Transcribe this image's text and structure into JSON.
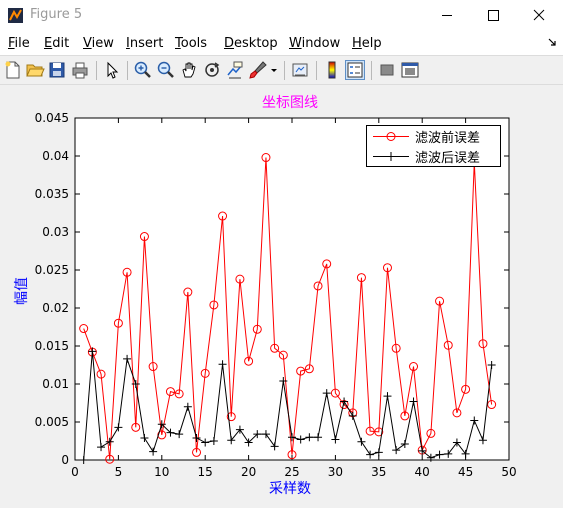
{
  "window": {
    "title": "Figure 5"
  },
  "menu": [
    {
      "mnemonic": "F",
      "rest": "ile"
    },
    {
      "mnemonic": "E",
      "rest": "dit"
    },
    {
      "mnemonic": "V",
      "rest": "iew"
    },
    {
      "mnemonic": "I",
      "rest": "nsert"
    },
    {
      "mnemonic": "T",
      "rest": "ools"
    },
    {
      "mnemonic": "D",
      "rest": "esktop"
    },
    {
      "mnemonic": "W",
      "rest": "indow"
    },
    {
      "mnemonic": "H",
      "rest": "elp"
    }
  ],
  "toolbar": [
    "new-figure-icon",
    "open-file-icon",
    "save-icon",
    "print-icon",
    "pointer-icon",
    "zoom-in-icon",
    "zoom-out-icon",
    "pan-icon",
    "rotate-3d-icon",
    "data-cursor-icon",
    "brush-icon",
    "link-icon",
    "colorbar-icon",
    "legend-icon",
    "hide-plot-tools-icon",
    "show-plot-tools-icon"
  ],
  "colors": {
    "series1": "#ff0000",
    "series2": "#000000",
    "title": "#ff00ff",
    "labels": "#0000ff"
  },
  "chart_data": {
    "type": "line",
    "title": "坐标图线",
    "xlabel": "采样数",
    "ylabel": "幅值",
    "xlim": [
      0,
      50
    ],
    "ylim": [
      0,
      0.045
    ],
    "xticks": [
      "0",
      "5",
      "10",
      "15",
      "20",
      "25",
      "30",
      "35",
      "40",
      "45",
      "50"
    ],
    "yticks": [
      "0",
      "0.005",
      "0.01",
      "0.015",
      "0.02",
      "0.025",
      "0.03",
      "0.035",
      "0.04",
      "0.045"
    ],
    "grid": false,
    "legend_position": "top-right",
    "x": [
      1,
      2,
      3,
      4,
      5,
      6,
      7,
      8,
      9,
      10,
      11,
      12,
      13,
      14,
      15,
      16,
      17,
      18,
      19,
      20,
      21,
      22,
      23,
      24,
      25,
      26,
      27,
      28,
      29,
      30,
      31,
      32,
      33,
      34,
      35,
      36,
      37,
      38,
      39,
      40,
      41,
      42,
      43,
      44,
      45,
      46,
      47,
      48
    ],
    "series": [
      {
        "name": "滤波前误差",
        "marker": "o",
        "values": [
          0.0173,
          0.0142,
          0.0113,
          0.0001,
          0.018,
          0.0247,
          0.0043,
          0.0294,
          0.0123,
          0.0033,
          0.009,
          0.0087,
          0.0221,
          0.001,
          0.0114,
          0.0204,
          0.0321,
          0.0057,
          0.0238,
          0.013,
          0.0172,
          0.0398,
          0.0147,
          0.0138,
          0.0007,
          0.0117,
          0.012,
          0.0229,
          0.0258,
          0.0088,
          0.0073,
          0.0062,
          0.024,
          0.0038,
          0.0037,
          0.0253,
          0.0147,
          0.0058,
          0.0123,
          0.0013,
          0.0035,
          0.0209,
          0.0151,
          0.0062,
          0.0093,
          0.0392,
          0.0153,
          0.0073
        ]
      },
      {
        "name": "滤波后误差",
        "marker": "+",
        "values": [
          0.0,
          0.0143,
          0.0017,
          0.0024,
          0.0043,
          0.0133,
          0.01,
          0.0029,
          0.0011,
          0.0047,
          0.0036,
          0.0034,
          0.007,
          0.0029,
          0.0023,
          0.0025,
          0.0126,
          0.0026,
          0.004,
          0.0023,
          0.0034,
          0.0034,
          0.0018,
          0.0104,
          0.003,
          0.0027,
          0.003,
          0.003,
          0.0088,
          0.0027,
          0.0077,
          0.0058,
          0.0024,
          0.0007,
          0.001,
          0.0084,
          0.0013,
          0.0021,
          0.0077,
          0.0012,
          0.0003,
          0.0007,
          0.0008,
          0.0023,
          0.0008,
          0.0052,
          0.0026,
          0.0125
        ]
      }
    ]
  }
}
